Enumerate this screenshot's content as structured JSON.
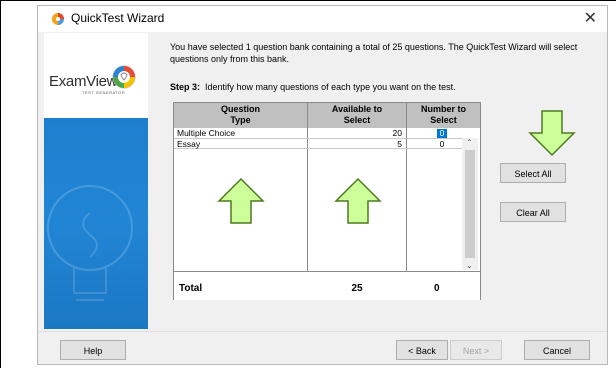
{
  "window": {
    "title": "QuickTest Wizard",
    "close_glyph": "✕"
  },
  "brand": {
    "logo_text": "ExamView",
    "logo_mark": "®",
    "logo_sub": "TEST GENERATOR"
  },
  "intro_text": "You have selected 1 question bank containing a total of 25 questions.  The QuickTest Wizard will select questions only from this bank.",
  "step": {
    "label": "Step 3:",
    "text": "Identify how many questions of each type you want on the test."
  },
  "table": {
    "headers": {
      "type": "Question Type",
      "available": "Available to Select",
      "select": "Number to Select"
    },
    "rows": [
      {
        "type": "Multiple Choice",
        "available": "20",
        "select": "0"
      },
      {
        "type": "Essay",
        "available": "5",
        "select": "0"
      }
    ],
    "total": {
      "label": "Total",
      "available": "25",
      "select": "0"
    }
  },
  "buttons": {
    "select_all": "Select All",
    "clear_all": "Clear All",
    "help": "Help",
    "back": "< Back",
    "next": "Next >",
    "cancel": "Cancel"
  },
  "colors": {
    "arrow_fill": "#ccff99",
    "arrow_stroke": "#4d7a1f",
    "side_blue": "#2185d5",
    "selection": "#0078d7"
  },
  "icons": {
    "title_icon": "quicktest-wizard-icon",
    "close": "close-icon",
    "lightbulb": "lightbulb-watermark-icon",
    "arrows": "green-arrow-icon"
  }
}
